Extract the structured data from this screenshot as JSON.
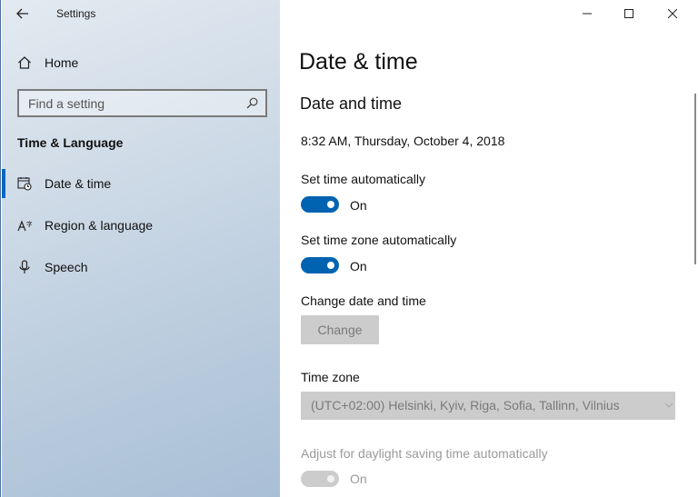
{
  "window": {
    "title": "Settings"
  },
  "sidebar": {
    "home_label": "Home",
    "search_placeholder": "Find a setting",
    "section_title": "Time & Language",
    "items": [
      {
        "label": "Date & time",
        "icon": "calendar-clock-icon",
        "active": true
      },
      {
        "label": "Region & language",
        "icon": "language-icon",
        "active": false
      },
      {
        "label": "Speech",
        "icon": "microphone-icon",
        "active": false
      }
    ]
  },
  "main": {
    "page_title": "Date & time",
    "section_title": "Date and time",
    "current_datetime": "8:32 AM, Thursday, October 4, 2018",
    "set_time_auto": {
      "label": "Set time automatically",
      "state": "On"
    },
    "set_tz_auto": {
      "label": "Set time zone automatically",
      "state": "On"
    },
    "change_datetime": {
      "label": "Change date and time",
      "button": "Change"
    },
    "time_zone": {
      "label": "Time zone",
      "value": "(UTC+02:00) Helsinki, Kyiv, Riga, Sofia, Tallinn, Vilnius"
    },
    "dst_auto": {
      "label": "Adjust for daylight saving time automatically",
      "state": "On"
    }
  },
  "colors": {
    "accent": "#0063b1",
    "disabled": "#cccccc",
    "disabled_text": "#9a9a9a"
  }
}
